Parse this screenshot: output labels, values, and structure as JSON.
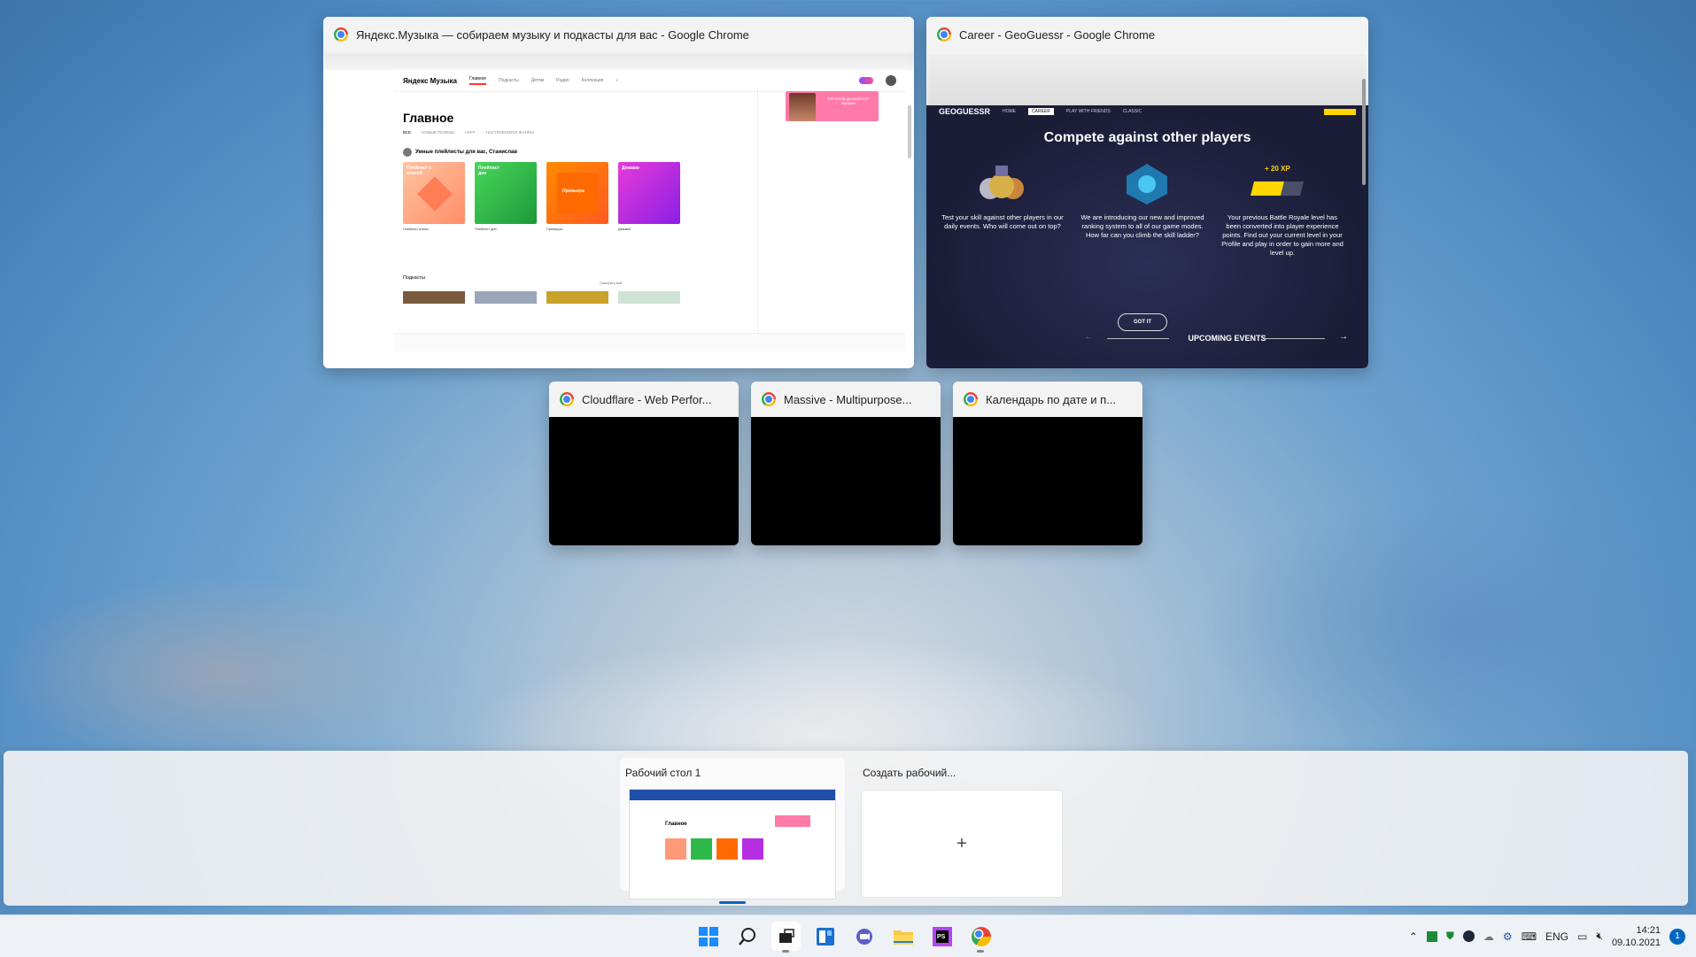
{
  "windows": {
    "yandex": {
      "title": "Яндекс.Музыка — собираем музыку и подкасты для вас - Google Chrome",
      "logo": "Яндекс Музыка",
      "nav": [
        "Главное",
        "Подкасты",
        "Детям",
        "Радио",
        "Коллекция"
      ],
      "heading": "Главное",
      "tabs": [
        "ВСЕ",
        "НОВЫЕ РЕЛИЗЫ",
        "ЧАРТ",
        "НАСТРОЕНИЯ И ЖАНРЫ"
      ],
      "smart_playlists": "Умные плейлисты для вас, Станислав",
      "cards": [
        "Плейлист с алисой",
        "Плейлист дня",
        "Премьера",
        "Дежавю"
      ],
      "card_captions": [
        "Плейлист алиса",
        "Плейлист дня",
        "Премьера",
        "Дежавю"
      ],
      "banner": "100 хитов русской поп-музыки",
      "podcasts": "Подкасты",
      "podcasts_more": "Смотреть всё"
    },
    "geoguessr": {
      "title": "Career - GeoGuessr - Google Chrome",
      "logo": "GEOGUESSR",
      "nav": [
        "HOME",
        "CAREER",
        "PLAY WITH FRIENDS",
        "CLASSIC"
      ],
      "heading": "Compete against other players",
      "xp": "+ 20 XP",
      "col1": "Test your skill against other players in our daily events. Who will come out on top?",
      "col2": "We are introducing our new and improved ranking system to all of our game modes. How far can you climb the skill ladder?",
      "col3": "Your previous Battle Royale level has been converted into player experience points. Find out your current level in your Profile and play in order to gain more and level up.",
      "button": "GOT IT",
      "upcoming": "UPCOMING EVENTS"
    },
    "thumbs": [
      {
        "title": "Cloudflare - Web Perfor..."
      },
      {
        "title": "Massive - Multipurpose..."
      },
      {
        "title": "Календарь по дате и п..."
      }
    ]
  },
  "desktops": {
    "desktop1": "Рабочий стол 1",
    "create": "Создать рабочий...",
    "plus": "+"
  },
  "taskbar": {
    "lang": "ENG",
    "time": "14:21",
    "date": "09.10.2021",
    "notifications": "1"
  },
  "colors": {
    "accent": "#0067c0",
    "geo_yellow": "#ffd600"
  }
}
